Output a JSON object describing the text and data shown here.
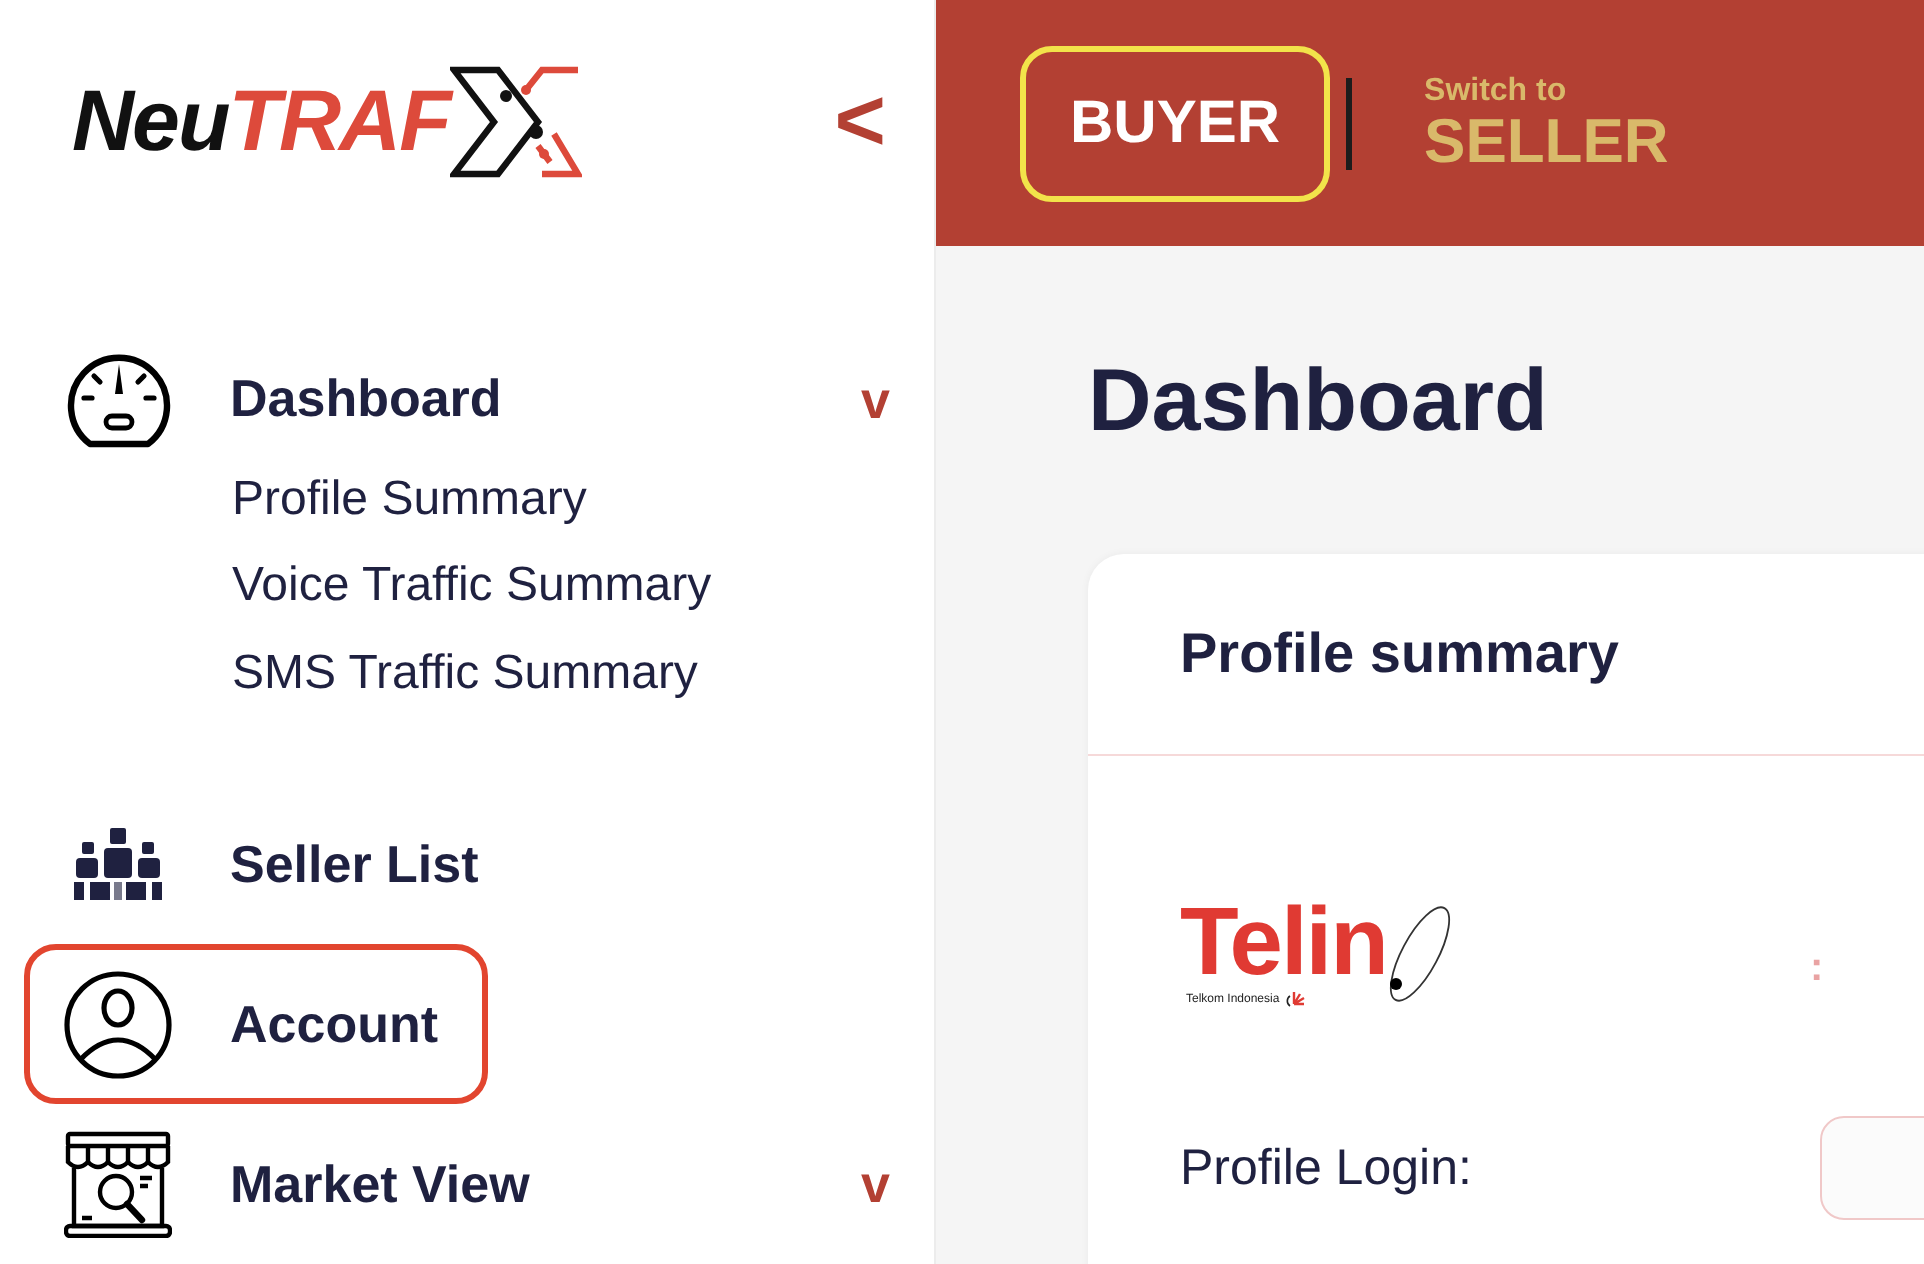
{
  "brand": {
    "name_dark": "Neu",
    "name_accent": "TRAF"
  },
  "sidebar": {
    "collapse_glyph": "<",
    "items": [
      {
        "label": "Dashboard",
        "selected": false,
        "chevron": "v",
        "children": [
          {
            "label": "Profile Summary",
            "selected": false
          },
          {
            "label": "Voice Traffic Summary",
            "selected": false
          },
          {
            "label": "SMS Traffic Summary",
            "selected": false
          }
        ]
      },
      {
        "label": "Seller List",
        "selected": false
      },
      {
        "label": "Account",
        "selected": true
      },
      {
        "label": "Market View",
        "selected": false,
        "chevron": "v"
      }
    ]
  },
  "header": {
    "current_role": "BUYER",
    "switch_hint": "Switch to",
    "switch_role": "SELLER"
  },
  "page_title": "Dashboard",
  "profile_card": {
    "title": "Profile summary",
    "company_logo": {
      "wordmark": "Telin",
      "tagline": "Telkom Indonesia"
    },
    "logo_separator": ":",
    "fields": [
      {
        "label": "Profile Login:"
      }
    ]
  }
}
